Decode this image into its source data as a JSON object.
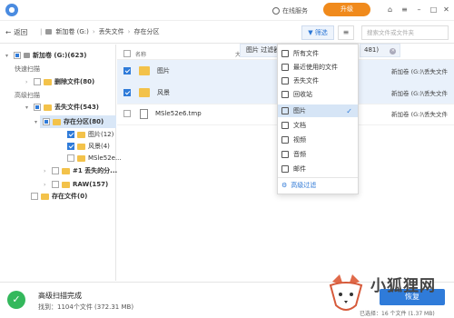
{
  "titlebar": {
    "online_service": "在线服务",
    "upgrade": "升级"
  },
  "nav": {
    "back": "返回",
    "crumbs": [
      "新加卷 (G:)",
      "丢失文件",
      "存在分区"
    ],
    "filter": "筛选",
    "search_placeholder": "搜索文件或文件夹"
  },
  "tree": {
    "root": "新加卷 (G:)(623)",
    "quick_scan": "快速扫描",
    "deleted": "删除文件(80)",
    "advanced_scan": "高级扫描",
    "lost": "丢失文件(543)",
    "existing": "存在分区(80)",
    "pictures": "图片(12)",
    "scenery": "风景(4)",
    "tmp": "MSle52e...",
    "lost_part": "#1 丢失的分...",
    "raw": "RAW(157)",
    "existing2": "存在文件(0)"
  },
  "list": {
    "col_name": "名称",
    "col_size": "大",
    "rows": [
      {
        "name": "图片",
        "path": "新加卷 (G:)\\丢失文件",
        "checked": true
      },
      {
        "name": "风景",
        "path": "新加卷 (G:)\\丢失文件",
        "checked": true
      },
      {
        "name": "MSle52e6.tmp",
        "path": "新加卷 (G:)\\丢失文件",
        "checked": false
      }
    ]
  },
  "filter_tip": {
    "left": "图片 过滤器",
    "right": "481)"
  },
  "dropdown": {
    "items": [
      "所有文件",
      "最近使用的文件",
      "丢失文件",
      "回收站",
      "图片",
      "文档",
      "视频",
      "音频",
      "邮件"
    ],
    "active_index": 4,
    "advanced": "高级过滤"
  },
  "status": {
    "title": "高级扫描完成",
    "found": "找到：1104个文件 (372.31 MB)",
    "recover": "恢复",
    "selected": "已选择：16 个文件 (1.37 MB)"
  },
  "watermark": "小狐狸网",
  "colors": {
    "accent": "#2f7bd9",
    "orange": "#f08a1c",
    "success": "#34b85c"
  }
}
